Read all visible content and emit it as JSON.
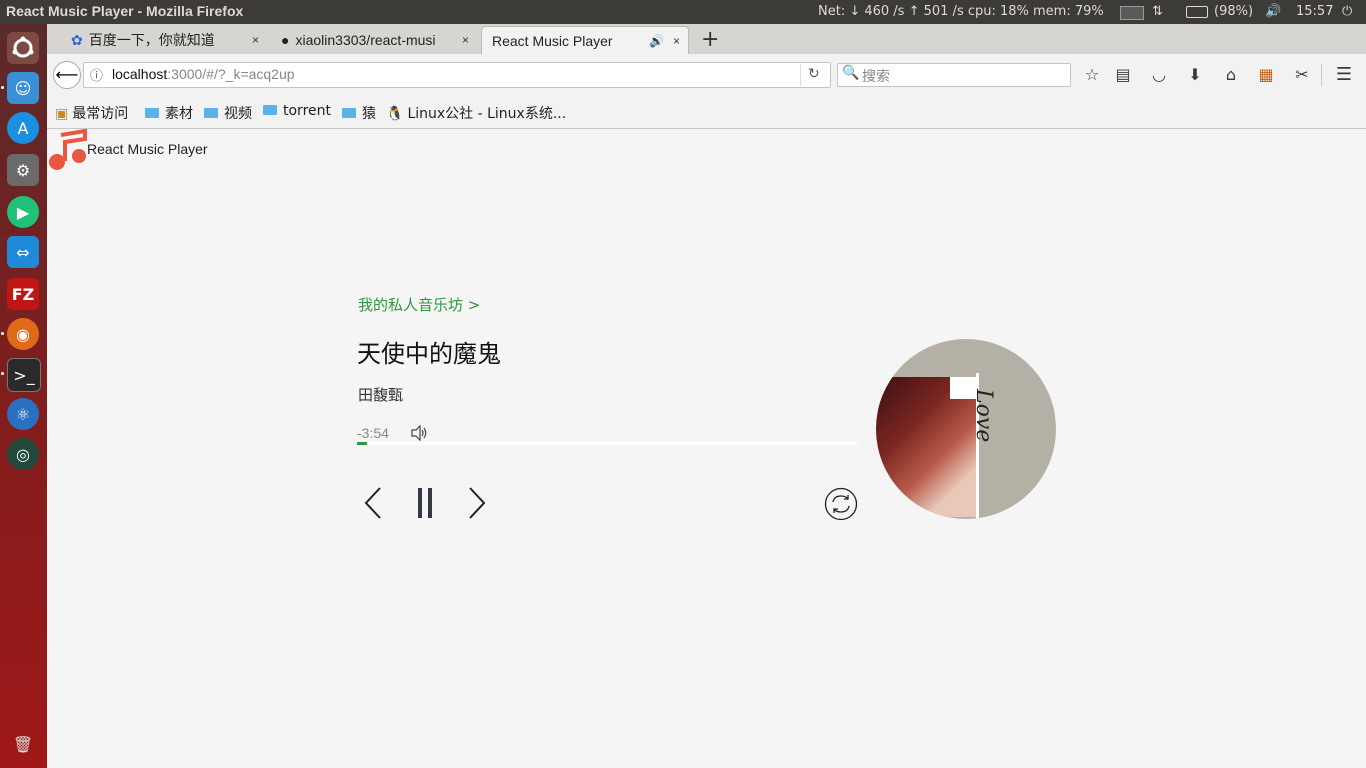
{
  "system": {
    "window_title": "React Music Player - Mozilla Firefox",
    "net": "Net: ↓ 460  /s ↑ 501  /s cpu: 18% mem: 79%",
    "battery": "(98%)",
    "clock": "15:57"
  },
  "tabs": [
    {
      "label": "百度一下，你就知道",
      "close": "×"
    },
    {
      "label": "xiaolin3303/react-musi",
      "close": "×"
    },
    {
      "label": "React Music Player",
      "close": "×"
    }
  ],
  "new_tab": "+",
  "nav": {
    "url_host": "localhost",
    "url_rest": ":3000/#/?_k=acq2up",
    "search_placeholder": "搜索"
  },
  "bookmarks": [
    "最常访问",
    "素材",
    "视频",
    "torrent",
    "猿",
    "Linux公社 - Linux系统..."
  ],
  "app": {
    "title": "React Music Player",
    "playlist_link": "我的私人音乐坊 >",
    "song_title": "天使中的魔鬼",
    "artist": "田馥甄",
    "time_left": "-3:54",
    "progress": 0.02,
    "accent": "#2f9842"
  },
  "cover": {
    "text": "Love"
  }
}
